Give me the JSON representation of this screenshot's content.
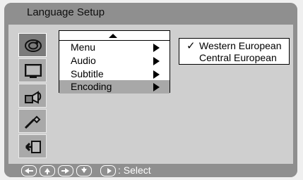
{
  "header": {
    "title": "Language Setup"
  },
  "sidebar": {
    "items": [
      {
        "name": "language-icon",
        "selected": true
      },
      {
        "name": "tv-icon",
        "selected": false
      },
      {
        "name": "audio-icon",
        "selected": false
      },
      {
        "name": "tools-icon",
        "selected": false
      },
      {
        "name": "exit-icon",
        "selected": false
      }
    ]
  },
  "menu": {
    "items": [
      {
        "label": "Menu"
      },
      {
        "label": "Audio"
      },
      {
        "label": "Subtitle"
      },
      {
        "label": "Encoding",
        "selected": true
      }
    ]
  },
  "submenu": {
    "items": [
      {
        "label": "Western European",
        "checked": true,
        "check": "✓"
      },
      {
        "label": "Central European",
        "checked": false
      }
    ]
  },
  "hint": {
    "text": ": Select"
  },
  "colors": {
    "frame": "#8f8f8f",
    "content": "#cfcfcf",
    "selected_row": "#a8a8a8"
  }
}
